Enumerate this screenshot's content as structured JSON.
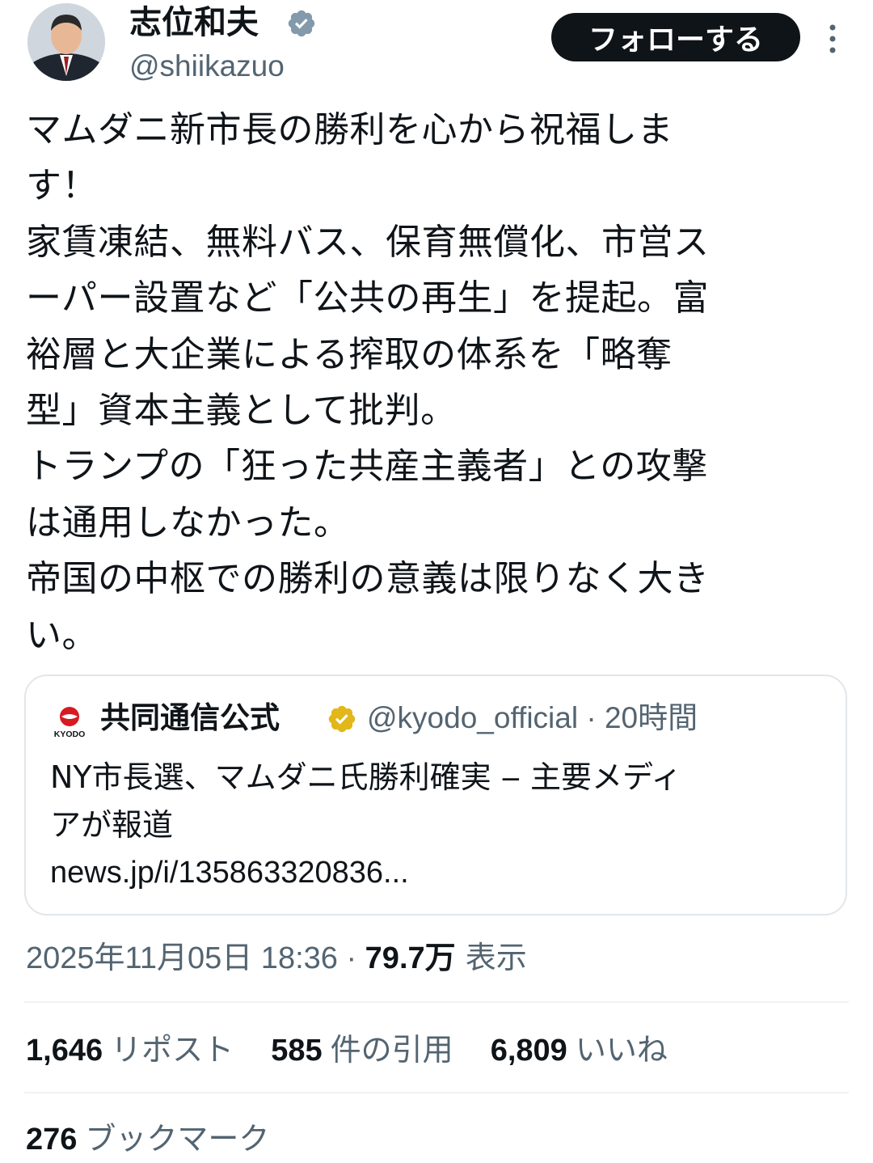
{
  "author": {
    "name": "志位和夫",
    "handle": "@shiikazuo",
    "follow_label": "フォローする"
  },
  "tweet": {
    "lines": [
      "マムダニ新市長の勝利を心から祝福しま",
      "す！",
      "家賃凍結、無料バス、保育無償化、市営ス",
      "ーパー設置など「公共の再生」を提起。富",
      "裕層と大企業による搾取の体系を「略奪",
      "型」資本主義として批判。",
      "トランプの「狂った共産主義者」との攻撃",
      "は通用しなかった。",
      "帝国の中枢での勝利の意義は限りなく大き",
      "い。"
    ]
  },
  "quote": {
    "logo_text": "KYODO",
    "name": "共同通信公式",
    "handle_time": "@kyodo_official · 20時間",
    "body_lines": [
      "NY市長選、マムダニ氏勝利確実 ‒ 主要メディ",
      "アが報道"
    ],
    "link": "news.jp/i/135863320836..."
  },
  "meta": {
    "timestamp": "2025年11月05日 18:36 · ",
    "views_count": "79.7万",
    "views_label": " 表示"
  },
  "stats": {
    "reposts": {
      "count": "1,646",
      "label": "リポスト"
    },
    "quotes": {
      "count": "585",
      "label": "件の引用"
    },
    "likes": {
      "count": "6,809",
      "label": "いいね"
    },
    "bookmarks": {
      "count": "276",
      "label": "ブックマーク"
    }
  },
  "colors": {
    "text": "#0f1419",
    "secondary": "#536471",
    "button_bg": "#0f1419",
    "verified_grey": "#829aab",
    "verified_gold": "#e2b719",
    "kyodo_red": "#d71a21"
  },
  "icons": {
    "verified_author": "verified-badge-grey-icon",
    "verified_quote": "verified-badge-gold-icon",
    "more": "more-vertical-icon",
    "logo": "kyodo-logo"
  }
}
